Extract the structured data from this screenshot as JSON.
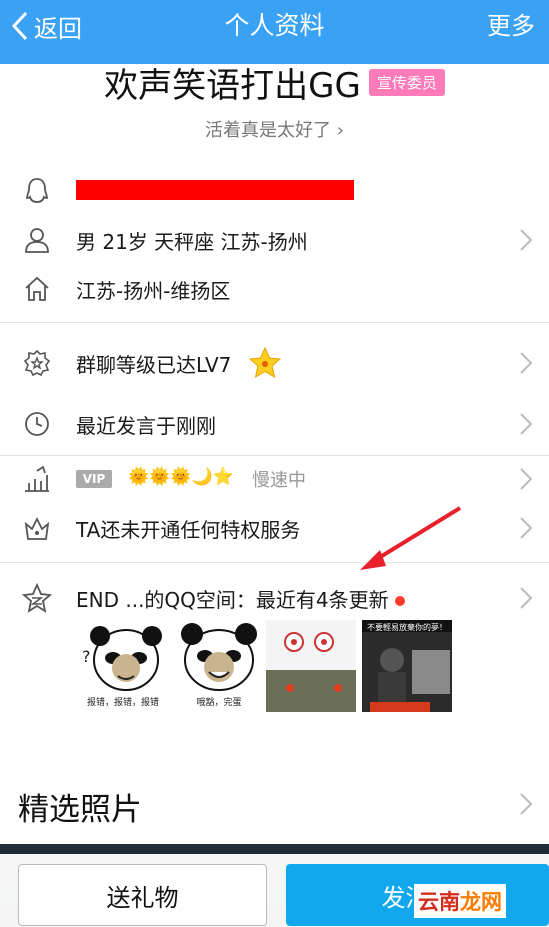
{
  "navbar": {
    "back_label": "返回",
    "title": "个人资料",
    "more_label": "更多"
  },
  "profile": {
    "nickname": "欢声笑语打出GG",
    "badge": "宣传委员",
    "signature": "活着真是太好了 ›"
  },
  "info": {
    "basic": "男  21岁  天秤座  江苏-扬州",
    "hometown": "江苏-扬州-维扬区"
  },
  "activity": {
    "group_level": "群聊等级已达LV7",
    "last_speak": "最近发言于刚刚"
  },
  "vip": {
    "tag": "VIP",
    "level_icons": "🌞🌞🌞🌙⭐",
    "speed": "慢速中",
    "privilege": "TA还未开通任何特权服务"
  },
  "qzone": {
    "text": "END  ...的QQ空间：最近有4条更新",
    "thumbs": [
      {
        "caption": "报错，报错，报错"
      },
      {
        "caption": "哦豁，完蛋"
      },
      {
        "caption": ""
      },
      {
        "caption": "不要輕易放棄你的夢！"
      }
    ]
  },
  "photos": {
    "title": "精选照片"
  },
  "actions": {
    "gift_label": "送礼物",
    "message_label": "发消息"
  },
  "watermark": {
    "part1": "云南",
    "part2": "龙网"
  },
  "colors": {
    "navbar": "#3aa2f5",
    "badge": "#ff7ab8",
    "primary_button": "#11a8ee",
    "arrow": "#e8202a"
  }
}
